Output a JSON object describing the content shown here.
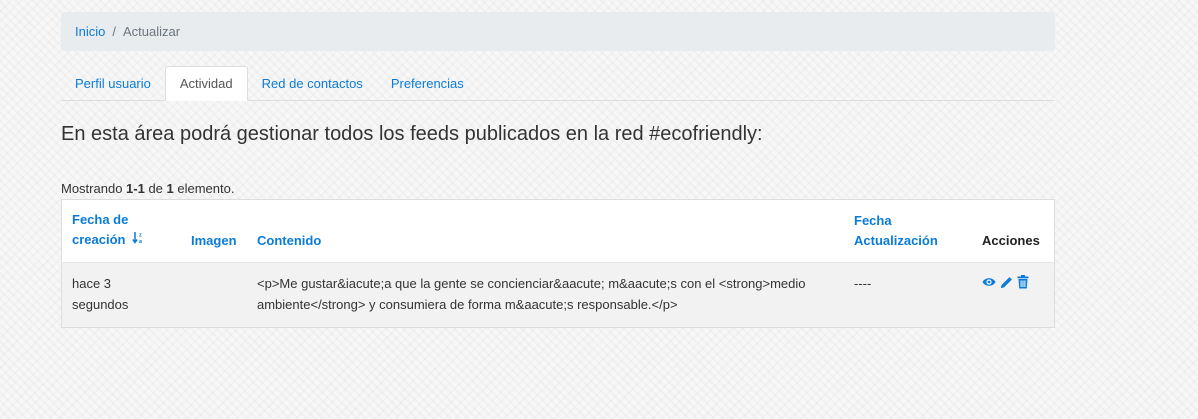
{
  "breadcrumb": {
    "home": "Inicio",
    "separator": "/",
    "current": "Actualizar"
  },
  "tabs": [
    {
      "label": "Perfil usuario"
    },
    {
      "label": "Actividad"
    },
    {
      "label": "Red de contactos"
    },
    {
      "label": "Preferencias"
    }
  ],
  "heading": "En esta área podrá gestionar todos los feeds publicados en la red #ecofriendly:",
  "summary": {
    "prefix": "Mostrando ",
    "range": "1-1",
    "middle": " de ",
    "total": "1",
    "suffix": " elemento."
  },
  "table": {
    "headers": {
      "fecha_creacion": "Fecha de creación",
      "imagen": "Imagen",
      "contenido": "Contenido",
      "fecha_actualizacion": "Fecha Actualización",
      "acciones": "Acciones"
    },
    "rows": [
      {
        "fecha_creacion": "hace 3 segundos",
        "imagen": "",
        "contenido": "<p>Me gustar&iacute;a que la gente se concienciar&aacute; m&aacute;s con el <strong>medio ambiente</strong> y consumiera de forma m&aacute;s responsable.</p>",
        "fecha_actualizacion": "----"
      }
    ]
  },
  "icons": {
    "view": "eye-icon",
    "edit": "pencil-icon",
    "delete": "trash-icon",
    "sort": "sort-alpha-icon"
  },
  "colors": {
    "link": "#0a7bd8",
    "breadcrumb_bg": "#e9ecef",
    "row_bg": "#f2f2f2"
  }
}
